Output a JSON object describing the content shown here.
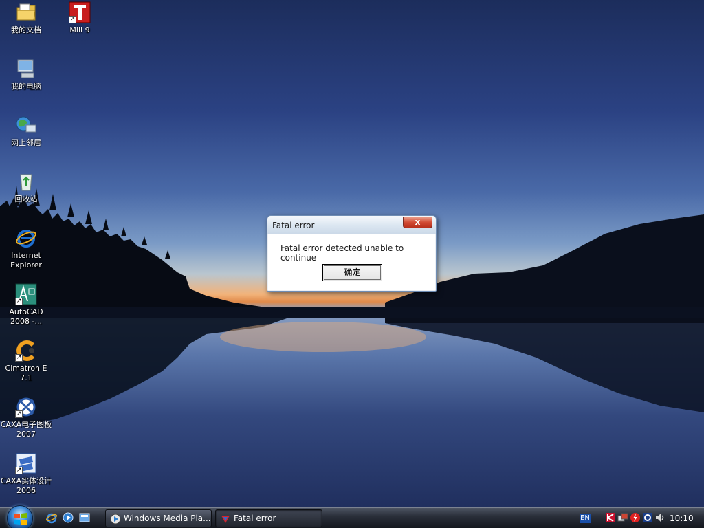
{
  "desktop": {
    "icons": [
      {
        "label": "我的文档",
        "icon": "my-documents-icon"
      },
      {
        "label": "Mill 9",
        "icon": "mill9-icon"
      },
      {
        "label": "我的电脑",
        "icon": "my-computer-icon"
      },
      {
        "label": "网上邻居",
        "icon": "network-places-icon"
      },
      {
        "label": "回收站",
        "icon": "recycle-bin-icon"
      },
      {
        "label": "Internet Explorer",
        "icon": "internet-explorer-icon"
      },
      {
        "label": "AutoCAD 2008 -...",
        "icon": "autocad-icon"
      },
      {
        "label": "Cimatron E 7.1",
        "icon": "cimatron-icon"
      },
      {
        "label": "CAXA电子图板2007",
        "icon": "caxa-drafting-icon"
      },
      {
        "label": "CAXA实体设计2006",
        "icon": "caxa-solid-icon"
      }
    ]
  },
  "dialog": {
    "title": "Fatal error",
    "close_label": "x",
    "message": "Fatal error detected unable to continue",
    "ok_label": "确定"
  },
  "taskbar": {
    "tasks": [
      {
        "label": "Windows Media Pla...",
        "icon": "media-player-icon"
      },
      {
        "label": "Fatal error",
        "icon": "app-icon"
      }
    ],
    "language": "EN",
    "clock": "10:10"
  },
  "colors": {
    "close_button": "#d24b34",
    "taskbar": "#2a2f3a",
    "dialog_frame": "#6f8db4"
  }
}
